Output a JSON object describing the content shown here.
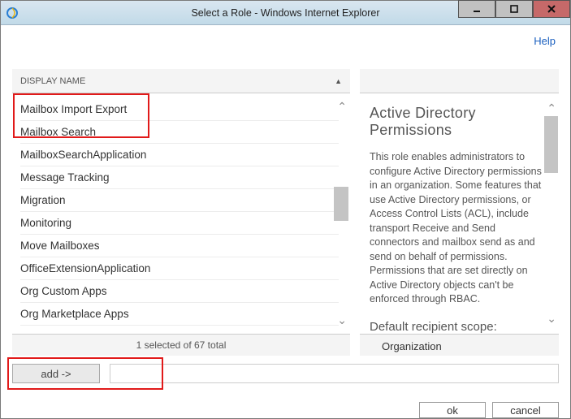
{
  "window": {
    "title": "Select a Role - Windows Internet Explorer",
    "help": "Help"
  },
  "list": {
    "header": "DISPLAY NAME",
    "items": [
      "Mailbox Import Export",
      "Mailbox Search",
      "MailboxSearchApplication",
      "Message Tracking",
      "Migration",
      "Monitoring",
      "Move Mailboxes",
      "OfficeExtensionApplication",
      "Org Custom Apps",
      "Org Marketplace Apps"
    ],
    "status": "1 selected of 67 total"
  },
  "details": {
    "title": "Active Directory Permissions",
    "desc": "This role enables administrators to configure Active Directory permissions in an organization. Some features that use Active Directory permissions, or Access Control Lists (ACL), include transport Receive and Send connectors and mailbox send as and send on behalf of permissions. Permissions that are set directly on Active Directory objects can't be enforced through RBAC.",
    "scope_label": "Default recipient scope:",
    "scope_value": "Organization"
  },
  "actions": {
    "add": "add ->",
    "ok": "ok",
    "cancel": "cancel"
  }
}
